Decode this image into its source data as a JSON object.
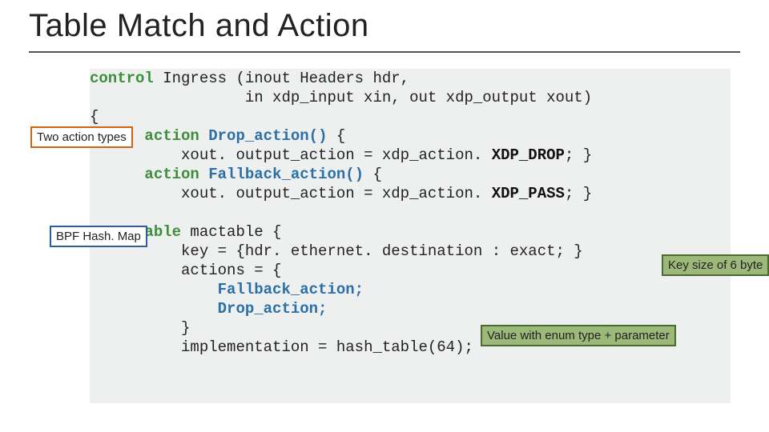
{
  "title": "Table Match and Action",
  "callouts": {
    "two_action_types": "Two action types",
    "bpf_hashmap": "BPF Hash. Map",
    "key_size": "Key size of 6 byte",
    "value_enum": "Value with enum type + parameter"
  },
  "code": {
    "kw_control": "control",
    "ingress_sig1": " Ingress (inout Headers hdr,",
    "ingress_sig2": "                 in xdp_input xin, out xdp_output xout)",
    "open_brace": "{",
    "kw_action1": "action",
    "drop_sig": "Drop_action()",
    "xout_assign1": "xout. output_action = xdp_action.",
    "xdp_drop": "XDP_DROP",
    "kw_action2": "action",
    "fallback_sig": "Fallback_action()",
    "xout_assign2": "xout. output_action = xdp_action.",
    "xdp_pass": "XDP_PASS",
    "kw_table": "table",
    "mactable": " mactable {",
    "key_line": "key = {hdr. ethernet. destination : exact; }",
    "actions_head": "actions = {",
    "fallback_action": "Fallback_action;",
    "drop_action": "Drop_action;",
    "actions_close": "}",
    "impl_line": "implementation = hash_table(64);"
  }
}
